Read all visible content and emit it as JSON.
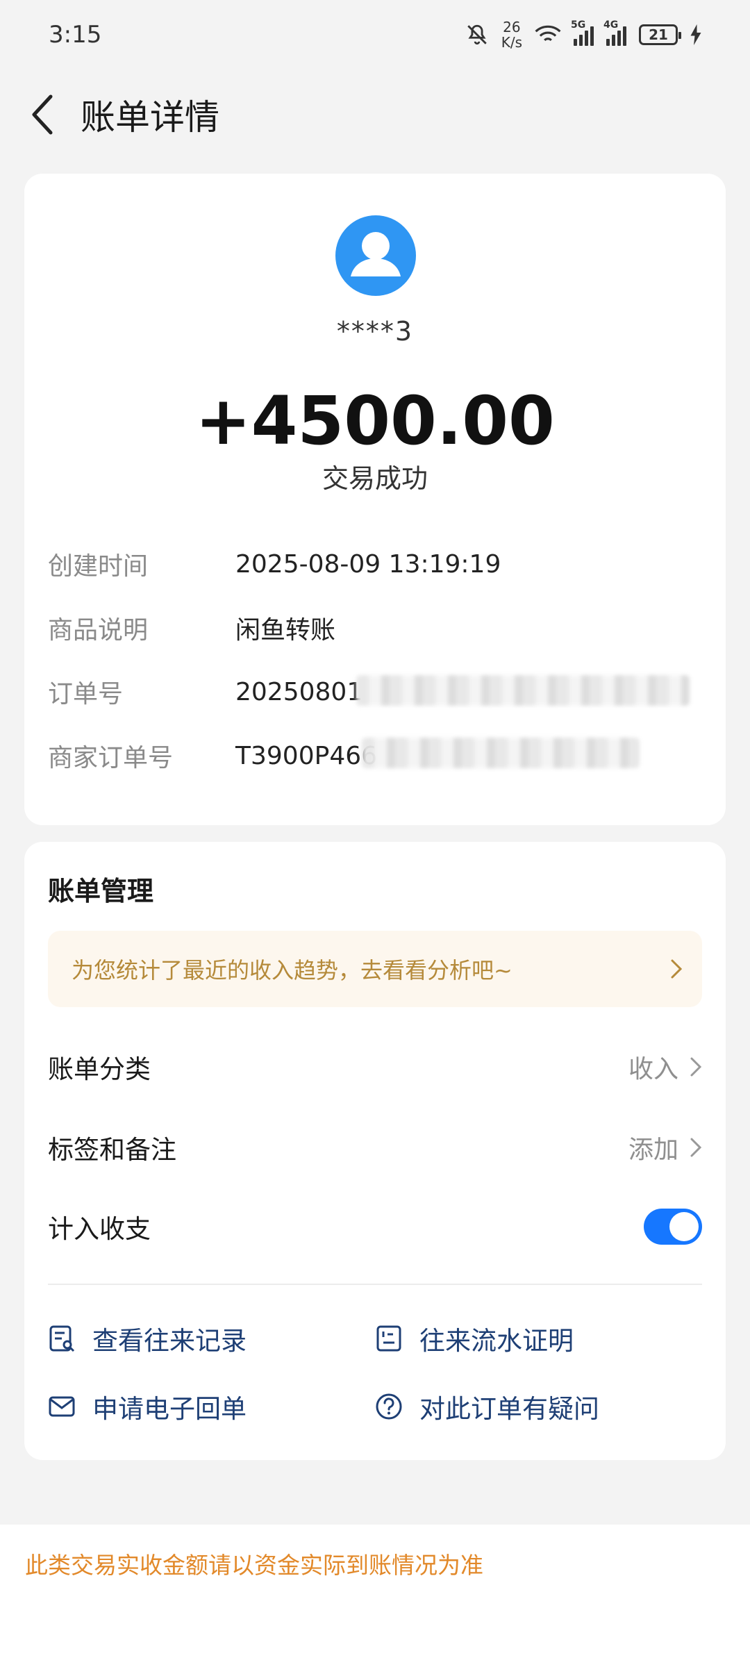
{
  "status_bar": {
    "time": "3:15",
    "net_speed_value": "26",
    "net_speed_unit": "K/s",
    "signal1_tag": "5G",
    "signal2_tag": "4G",
    "battery": "21"
  },
  "header": {
    "title": "账单详情"
  },
  "transaction": {
    "payer": "****3",
    "amount": "+4500.00",
    "status": "交易成功",
    "details": [
      {
        "label": "创建时间",
        "value": "2025-08-09 13:19:19"
      },
      {
        "label": "商品说明",
        "value": "闲鱼转账"
      },
      {
        "label": "订单号",
        "value": "20250801"
      },
      {
        "label": "商家订单号",
        "value": "T3900P466"
      }
    ]
  },
  "management": {
    "title": "账单管理",
    "banner": "为您统计了最近的收入趋势，去看看分析吧~",
    "rows": [
      {
        "label": "账单分类",
        "value": "收入"
      },
      {
        "label": "标签和备注",
        "value": "添加"
      },
      {
        "label": "计入收支",
        "toggle_on": true
      }
    ],
    "actions": [
      {
        "label": "查看往来记录",
        "icon": "records-icon"
      },
      {
        "label": "往来流水证明",
        "icon": "statement-icon"
      },
      {
        "label": "申请电子回单",
        "icon": "mail-icon"
      },
      {
        "label": "对此订单有疑问",
        "icon": "question-icon"
      }
    ]
  },
  "footer": {
    "note": "此类交易实收金额请以资金实际到账情况为准"
  },
  "colors": {
    "accent_blue": "#1677ff",
    "link_navy": "#1e3f75",
    "banner_text": "#b58a3a",
    "footer_note": "#e2892a",
    "avatar": "#2f96f3"
  }
}
